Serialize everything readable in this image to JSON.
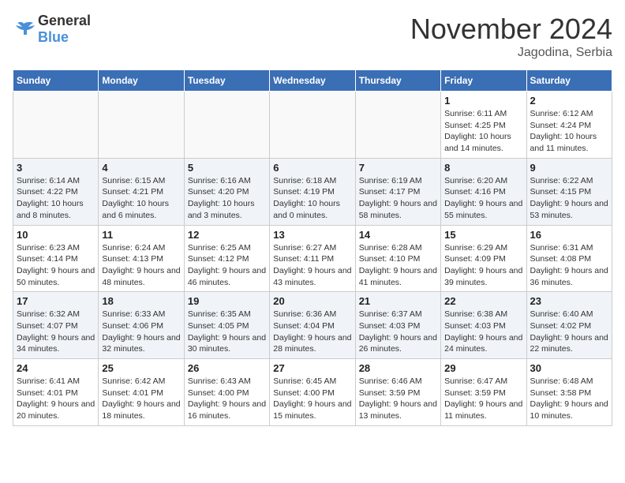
{
  "logo": {
    "general": "General",
    "blue": "Blue"
  },
  "header": {
    "month": "November 2024",
    "location": "Jagodina, Serbia"
  },
  "weekdays": [
    "Sunday",
    "Monday",
    "Tuesday",
    "Wednesday",
    "Thursday",
    "Friday",
    "Saturday"
  ],
  "weeks": [
    [
      {
        "day": "",
        "info": ""
      },
      {
        "day": "",
        "info": ""
      },
      {
        "day": "",
        "info": ""
      },
      {
        "day": "",
        "info": ""
      },
      {
        "day": "",
        "info": ""
      },
      {
        "day": "1",
        "info": "Sunrise: 6:11 AM\nSunset: 4:25 PM\nDaylight: 10 hours and 14 minutes."
      },
      {
        "day": "2",
        "info": "Sunrise: 6:12 AM\nSunset: 4:24 PM\nDaylight: 10 hours and 11 minutes."
      }
    ],
    [
      {
        "day": "3",
        "info": "Sunrise: 6:14 AM\nSunset: 4:22 PM\nDaylight: 10 hours and 8 minutes."
      },
      {
        "day": "4",
        "info": "Sunrise: 6:15 AM\nSunset: 4:21 PM\nDaylight: 10 hours and 6 minutes."
      },
      {
        "day": "5",
        "info": "Sunrise: 6:16 AM\nSunset: 4:20 PM\nDaylight: 10 hours and 3 minutes."
      },
      {
        "day": "6",
        "info": "Sunrise: 6:18 AM\nSunset: 4:19 PM\nDaylight: 10 hours and 0 minutes."
      },
      {
        "day": "7",
        "info": "Sunrise: 6:19 AM\nSunset: 4:17 PM\nDaylight: 9 hours and 58 minutes."
      },
      {
        "day": "8",
        "info": "Sunrise: 6:20 AM\nSunset: 4:16 PM\nDaylight: 9 hours and 55 minutes."
      },
      {
        "day": "9",
        "info": "Sunrise: 6:22 AM\nSunset: 4:15 PM\nDaylight: 9 hours and 53 minutes."
      }
    ],
    [
      {
        "day": "10",
        "info": "Sunrise: 6:23 AM\nSunset: 4:14 PM\nDaylight: 9 hours and 50 minutes."
      },
      {
        "day": "11",
        "info": "Sunrise: 6:24 AM\nSunset: 4:13 PM\nDaylight: 9 hours and 48 minutes."
      },
      {
        "day": "12",
        "info": "Sunrise: 6:25 AM\nSunset: 4:12 PM\nDaylight: 9 hours and 46 minutes."
      },
      {
        "day": "13",
        "info": "Sunrise: 6:27 AM\nSunset: 4:11 PM\nDaylight: 9 hours and 43 minutes."
      },
      {
        "day": "14",
        "info": "Sunrise: 6:28 AM\nSunset: 4:10 PM\nDaylight: 9 hours and 41 minutes."
      },
      {
        "day": "15",
        "info": "Sunrise: 6:29 AM\nSunset: 4:09 PM\nDaylight: 9 hours and 39 minutes."
      },
      {
        "day": "16",
        "info": "Sunrise: 6:31 AM\nSunset: 4:08 PM\nDaylight: 9 hours and 36 minutes."
      }
    ],
    [
      {
        "day": "17",
        "info": "Sunrise: 6:32 AM\nSunset: 4:07 PM\nDaylight: 9 hours and 34 minutes."
      },
      {
        "day": "18",
        "info": "Sunrise: 6:33 AM\nSunset: 4:06 PM\nDaylight: 9 hours and 32 minutes."
      },
      {
        "day": "19",
        "info": "Sunrise: 6:35 AM\nSunset: 4:05 PM\nDaylight: 9 hours and 30 minutes."
      },
      {
        "day": "20",
        "info": "Sunrise: 6:36 AM\nSunset: 4:04 PM\nDaylight: 9 hours and 28 minutes."
      },
      {
        "day": "21",
        "info": "Sunrise: 6:37 AM\nSunset: 4:03 PM\nDaylight: 9 hours and 26 minutes."
      },
      {
        "day": "22",
        "info": "Sunrise: 6:38 AM\nSunset: 4:03 PM\nDaylight: 9 hours and 24 minutes."
      },
      {
        "day": "23",
        "info": "Sunrise: 6:40 AM\nSunset: 4:02 PM\nDaylight: 9 hours and 22 minutes."
      }
    ],
    [
      {
        "day": "24",
        "info": "Sunrise: 6:41 AM\nSunset: 4:01 PM\nDaylight: 9 hours and 20 minutes."
      },
      {
        "day": "25",
        "info": "Sunrise: 6:42 AM\nSunset: 4:01 PM\nDaylight: 9 hours and 18 minutes."
      },
      {
        "day": "26",
        "info": "Sunrise: 6:43 AM\nSunset: 4:00 PM\nDaylight: 9 hours and 16 minutes."
      },
      {
        "day": "27",
        "info": "Sunrise: 6:45 AM\nSunset: 4:00 PM\nDaylight: 9 hours and 15 minutes."
      },
      {
        "day": "28",
        "info": "Sunrise: 6:46 AM\nSunset: 3:59 PM\nDaylight: 9 hours and 13 minutes."
      },
      {
        "day": "29",
        "info": "Sunrise: 6:47 AM\nSunset: 3:59 PM\nDaylight: 9 hours and 11 minutes."
      },
      {
        "day": "30",
        "info": "Sunrise: 6:48 AM\nSunset: 3:58 PM\nDaylight: 9 hours and 10 minutes."
      }
    ]
  ]
}
